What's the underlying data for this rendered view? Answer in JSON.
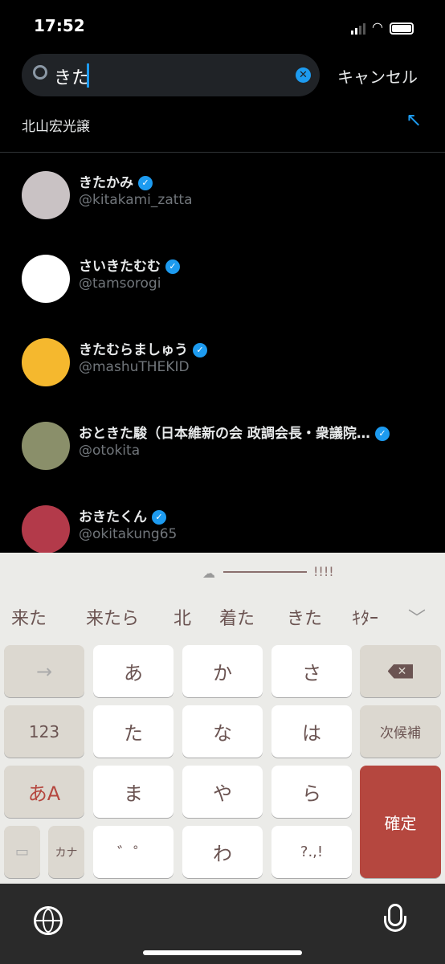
{
  "status": {
    "time": "17:52"
  },
  "search": {
    "query": "きた",
    "cancel": "キャンセル"
  },
  "suggestion": {
    "text": "北山宏光譲"
  },
  "users": [
    {
      "name": "きたかみ",
      "handle": "@kitakami_zatta",
      "avatar": "#c9c2c4"
    },
    {
      "name": "さいきたむむ",
      "handle": "@tamsorogi",
      "avatar": "#ffffff"
    },
    {
      "name": "きたむらましゅう",
      "handle": "@mashuTHEKID",
      "avatar": "#f5b82e"
    },
    {
      "name": "おときた駿（日本維新の会 政調会長・衆議院…",
      "handle": "@otokita",
      "avatar": "#8a8f6a"
    },
    {
      "name": "おきたくん",
      "handle": "@okitakung65",
      "avatar": "#b33a4a"
    }
  ],
  "keyboard": {
    "banner": "!!!!",
    "candidates": [
      "来た",
      "来たら",
      "北",
      "着た",
      "きた",
      "ｷﾀｰ"
    ],
    "keys": {
      "arrow": "→",
      "k1": "あ",
      "k2": "か",
      "k3": "さ",
      "num": "123",
      "k4": "た",
      "k5": "な",
      "k6": "は",
      "next": "次候補",
      "mode": "あA",
      "k7": "ま",
      "k8": "や",
      "k9": "ら",
      "confirm": "確定",
      "kana": "カナ",
      "k10": "゛゜",
      "k11": "わ",
      "k12": "?.,!"
    }
  },
  "colors": {
    "accent": "#1d9bf0",
    "confirm": "#b5473f"
  }
}
